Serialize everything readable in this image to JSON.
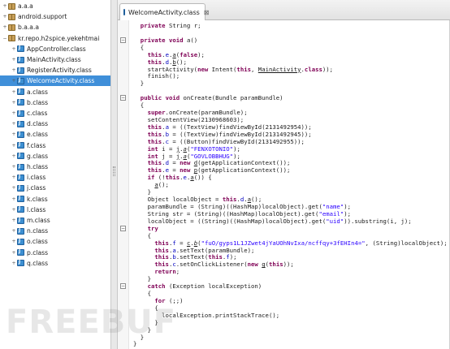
{
  "tree": {
    "items": [
      {
        "label": "a.a.a",
        "kind": "package",
        "toggle": "+"
      },
      {
        "label": "android.support",
        "kind": "package",
        "toggle": "+"
      },
      {
        "label": "b.a.a.a",
        "kind": "package",
        "toggle": "+"
      },
      {
        "label": "kr.repo.h2spice.yekehtmai",
        "kind": "package",
        "toggle": "−"
      },
      {
        "label": "AppController.class",
        "kind": "class",
        "toggle": "+"
      },
      {
        "label": "MainActivity.class",
        "kind": "class",
        "toggle": "+"
      },
      {
        "label": "RegisterActivity.class",
        "kind": "class",
        "toggle": "+"
      },
      {
        "label": "WelcomeActivity.class",
        "kind": "class",
        "toggle": "+",
        "selected": true
      },
      {
        "label": "a.class",
        "kind": "class",
        "toggle": "+"
      },
      {
        "label": "b.class",
        "kind": "class",
        "toggle": "+"
      },
      {
        "label": "c.class",
        "kind": "class",
        "toggle": "+"
      },
      {
        "label": "d.class",
        "kind": "class",
        "toggle": "+"
      },
      {
        "label": "e.class",
        "kind": "class",
        "toggle": "+"
      },
      {
        "label": "f.class",
        "kind": "class",
        "toggle": "+"
      },
      {
        "label": "g.class",
        "kind": "class",
        "toggle": "+"
      },
      {
        "label": "h.class",
        "kind": "class",
        "toggle": "+"
      },
      {
        "label": "i.class",
        "kind": "class",
        "toggle": "+"
      },
      {
        "label": "j.class",
        "kind": "class",
        "toggle": "+"
      },
      {
        "label": "k.class",
        "kind": "class",
        "toggle": "+"
      },
      {
        "label": "l.class",
        "kind": "class",
        "toggle": "+"
      },
      {
        "label": "m.class",
        "kind": "class",
        "toggle": "+"
      },
      {
        "label": "n.class",
        "kind": "class",
        "toggle": "+"
      },
      {
        "label": "o.class",
        "kind": "class",
        "toggle": "+"
      },
      {
        "label": "p.class",
        "kind": "class",
        "toggle": "+"
      },
      {
        "label": "q.class",
        "kind": "class",
        "toggle": "+"
      }
    ]
  },
  "editor": {
    "tab_label": "WelcomeActivity.class",
    "tab_close": "⊠",
    "code_lines": [
      [
        {
          "t": "  "
        },
        {
          "t": "private",
          "c": "kw"
        },
        {
          "t": " String r;"
        }
      ],
      [
        {
          "t": ""
        }
      ],
      [
        {
          "t": "  "
        },
        {
          "t": "private",
          "c": "kw"
        },
        {
          "t": " "
        },
        {
          "t": "void",
          "c": "kw"
        },
        {
          "t": " a()"
        }
      ],
      [
        {
          "t": "  {"
        }
      ],
      [
        {
          "t": "    "
        },
        {
          "t": "this",
          "c": "kw"
        },
        {
          "t": "."
        },
        {
          "t": "e",
          "c": "fld"
        },
        {
          "t": "."
        },
        {
          "t": "a",
          "c": "ul"
        },
        {
          "t": "("
        },
        {
          "t": "false",
          "c": "kw"
        },
        {
          "t": ");"
        }
      ],
      [
        {
          "t": "    "
        },
        {
          "t": "this",
          "c": "kw"
        },
        {
          "t": "."
        },
        {
          "t": "d",
          "c": "fld"
        },
        {
          "t": "."
        },
        {
          "t": "b",
          "c": "ul"
        },
        {
          "t": "();"
        }
      ],
      [
        {
          "t": "    startActivity("
        },
        {
          "t": "new",
          "c": "kw"
        },
        {
          "t": " Intent("
        },
        {
          "t": "this",
          "c": "kw"
        },
        {
          "t": ", "
        },
        {
          "t": "MainActivity",
          "c": "ul"
        },
        {
          "t": "."
        },
        {
          "t": "class",
          "c": "kw"
        },
        {
          "t": "));"
        }
      ],
      [
        {
          "t": "    finish();"
        }
      ],
      [
        {
          "t": "  }"
        }
      ],
      [
        {
          "t": ""
        }
      ],
      [
        {
          "t": "  "
        },
        {
          "t": "public",
          "c": "kw"
        },
        {
          "t": " "
        },
        {
          "t": "void",
          "c": "kw"
        },
        {
          "t": " onCreate(Bundle paramBundle)"
        }
      ],
      [
        {
          "t": "  {"
        }
      ],
      [
        {
          "t": "    "
        },
        {
          "t": "super",
          "c": "kw"
        },
        {
          "t": ".onCreate(paramBundle);"
        }
      ],
      [
        {
          "t": "    setContentView(2130968603);"
        }
      ],
      [
        {
          "t": "    "
        },
        {
          "t": "this",
          "c": "kw"
        },
        {
          "t": "."
        },
        {
          "t": "a",
          "c": "fld"
        },
        {
          "t": " = ((TextView)findViewById(2131492954));"
        }
      ],
      [
        {
          "t": "    "
        },
        {
          "t": "this",
          "c": "kw"
        },
        {
          "t": "."
        },
        {
          "t": "b",
          "c": "fld"
        },
        {
          "t": " = ((TextView)findViewById(2131492945));"
        }
      ],
      [
        {
          "t": "    "
        },
        {
          "t": "this",
          "c": "kw"
        },
        {
          "t": "."
        },
        {
          "t": "c",
          "c": "fld"
        },
        {
          "t": " = ((Button)findViewById(2131492955));"
        }
      ],
      [
        {
          "t": "    "
        },
        {
          "t": "int",
          "c": "kw"
        },
        {
          "t": " i = "
        },
        {
          "t": "j",
          "c": "ul"
        },
        {
          "t": "."
        },
        {
          "t": "a",
          "c": "ul ital"
        },
        {
          "t": "("
        },
        {
          "t": "\"FENXOTONIO\"",
          "c": "str"
        },
        {
          "t": ");"
        }
      ],
      [
        {
          "t": "    "
        },
        {
          "t": "int",
          "c": "kw"
        },
        {
          "t": " j = "
        },
        {
          "t": "j",
          "c": "ul"
        },
        {
          "t": "."
        },
        {
          "t": "a",
          "c": "ul ital"
        },
        {
          "t": "("
        },
        {
          "t": "\"GOVLOBBHUG\"",
          "c": "str"
        },
        {
          "t": ");"
        }
      ],
      [
        {
          "t": "    "
        },
        {
          "t": "this",
          "c": "kw"
        },
        {
          "t": "."
        },
        {
          "t": "d",
          "c": "fld"
        },
        {
          "t": " = "
        },
        {
          "t": "new",
          "c": "kw"
        },
        {
          "t": " "
        },
        {
          "t": "d",
          "c": "ul"
        },
        {
          "t": "(getApplicationContext());"
        }
      ],
      [
        {
          "t": "    "
        },
        {
          "t": "this",
          "c": "kw"
        },
        {
          "t": "."
        },
        {
          "t": "e",
          "c": "fld"
        },
        {
          "t": " = "
        },
        {
          "t": "new",
          "c": "kw"
        },
        {
          "t": " "
        },
        {
          "t": "p",
          "c": "ul"
        },
        {
          "t": "(getApplicationContext());"
        }
      ],
      [
        {
          "t": "    "
        },
        {
          "t": "if",
          "c": "kw"
        },
        {
          "t": " (!"
        },
        {
          "t": "this",
          "c": "kw"
        },
        {
          "t": "."
        },
        {
          "t": "e",
          "c": "fld"
        },
        {
          "t": "."
        },
        {
          "t": "a",
          "c": "ul"
        },
        {
          "t": "()) {"
        }
      ],
      [
        {
          "t": "      "
        },
        {
          "t": "a",
          "c": "ul"
        },
        {
          "t": "();"
        }
      ],
      [
        {
          "t": "    }"
        }
      ],
      [
        {
          "t": "    Object localObject = "
        },
        {
          "t": "this",
          "c": "kw"
        },
        {
          "t": "."
        },
        {
          "t": "d",
          "c": "fld"
        },
        {
          "t": "."
        },
        {
          "t": "a",
          "c": "ul"
        },
        {
          "t": "();"
        }
      ],
      [
        {
          "t": "    paramBundle = (String)((HashMap)localObject).get("
        },
        {
          "t": "\"name\"",
          "c": "str"
        },
        {
          "t": ");"
        }
      ],
      [
        {
          "t": "    String str = (String)((HashMap)localObject).get("
        },
        {
          "t": "\"email\"",
          "c": "str"
        },
        {
          "t": ");"
        }
      ],
      [
        {
          "t": "    localObject = ((String)((HashMap)localObject).get("
        },
        {
          "t": "\"uid\"",
          "c": "str"
        },
        {
          "t": ")).substring(i, j);"
        }
      ],
      [
        {
          "t": "    "
        },
        {
          "t": "try",
          "c": "kw"
        }
      ],
      [
        {
          "t": "    {"
        }
      ],
      [
        {
          "t": "      "
        },
        {
          "t": "this",
          "c": "kw"
        },
        {
          "t": "."
        },
        {
          "t": "f",
          "c": "fld"
        },
        {
          "t": " = "
        },
        {
          "t": "c",
          "c": "ul"
        },
        {
          "t": "."
        },
        {
          "t": "b",
          "c": "ul ital"
        },
        {
          "t": "("
        },
        {
          "t": "\"fuO/gyps1L1JZwet4jYaUOhNvIxa/ncffqy+3fEHIn4=\"",
          "c": "str"
        },
        {
          "t": ", (String)localObject);"
        }
      ],
      [
        {
          "t": "      "
        },
        {
          "t": "this",
          "c": "kw"
        },
        {
          "t": "."
        },
        {
          "t": "a",
          "c": "fld"
        },
        {
          "t": ".setText(paramBundle);"
        }
      ],
      [
        {
          "t": "      "
        },
        {
          "t": "this",
          "c": "kw"
        },
        {
          "t": "."
        },
        {
          "t": "b",
          "c": "fld"
        },
        {
          "t": ".setText("
        },
        {
          "t": "this",
          "c": "kw"
        },
        {
          "t": "."
        },
        {
          "t": "f",
          "c": "fld"
        },
        {
          "t": ");"
        }
      ],
      [
        {
          "t": "      "
        },
        {
          "t": "this",
          "c": "kw"
        },
        {
          "t": "."
        },
        {
          "t": "c",
          "c": "fld"
        },
        {
          "t": ".setOnClickListener("
        },
        {
          "t": "new",
          "c": "kw"
        },
        {
          "t": " "
        },
        {
          "t": "g",
          "c": "ul"
        },
        {
          "t": "("
        },
        {
          "t": "this",
          "c": "kw"
        },
        {
          "t": "));"
        }
      ],
      [
        {
          "t": "      "
        },
        {
          "t": "return",
          "c": "kw"
        },
        {
          "t": ";"
        }
      ],
      [
        {
          "t": "    }"
        }
      ],
      [
        {
          "t": "    "
        },
        {
          "t": "catch",
          "c": "kw"
        },
        {
          "t": " (Exception localException)"
        }
      ],
      [
        {
          "t": "    {"
        }
      ],
      [
        {
          "t": "      "
        },
        {
          "t": "for",
          "c": "kw"
        },
        {
          "t": " (;;)"
        }
      ],
      [
        {
          "t": "      {"
        }
      ],
      [
        {
          "t": "        localException.printStackTrace();"
        }
      ],
      [
        {
          "t": "      }"
        }
      ],
      [
        {
          "t": "    }"
        }
      ],
      [
        {
          "t": "  }"
        }
      ],
      [
        {
          "t": "}"
        }
      ]
    ],
    "fold_markers": [
      2,
      10,
      28,
      36
    ]
  },
  "watermark": {
    "text": "FREEBUF"
  },
  "colors": {
    "keyword": "#7f0055",
    "field": "#0000c0",
    "string": "#2a00ff",
    "selection": "#3f8fd9"
  }
}
